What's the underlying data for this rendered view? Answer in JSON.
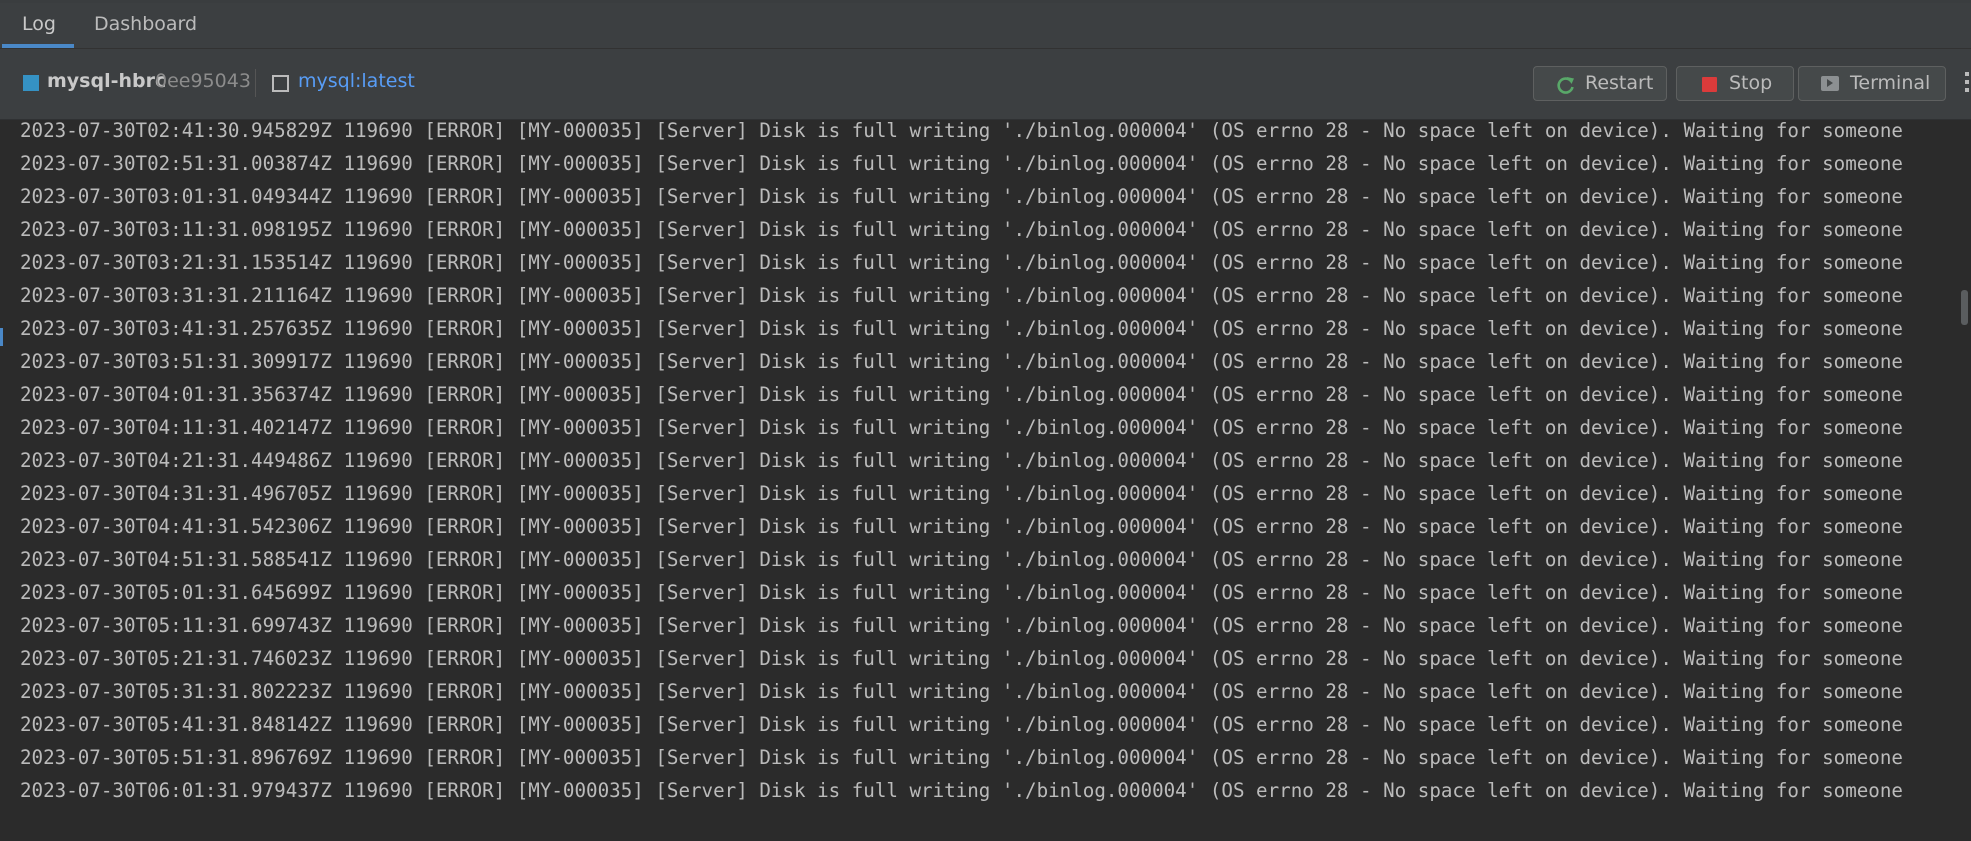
{
  "tabs": [
    {
      "label": "Log",
      "active": true
    },
    {
      "label": "Dashboard",
      "active": false
    }
  ],
  "toolbar": {
    "container_name": "mysql-hbrc",
    "container_id": "0ee95043",
    "image_name": "mysql:latest",
    "restart_label": "Restart",
    "stop_label": "Stop",
    "terminal_label": "Terminal"
  },
  "log": {
    "lines": [
      "2023-07-30T02:41:30.945829Z 119690 [ERROR] [MY-000035] [Server] Disk is full writing './binlog.000004' (OS errno 28 - No space left on device). Waiting for someone",
      "2023-07-30T02:51:31.003874Z 119690 [ERROR] [MY-000035] [Server] Disk is full writing './binlog.000004' (OS errno 28 - No space left on device). Waiting for someone",
      "2023-07-30T03:01:31.049344Z 119690 [ERROR] [MY-000035] [Server] Disk is full writing './binlog.000004' (OS errno 28 - No space left on device). Waiting for someone",
      "2023-07-30T03:11:31.098195Z 119690 [ERROR] [MY-000035] [Server] Disk is full writing './binlog.000004' (OS errno 28 - No space left on device). Waiting for someone",
      "2023-07-30T03:21:31.153514Z 119690 [ERROR] [MY-000035] [Server] Disk is full writing './binlog.000004' (OS errno 28 - No space left on device). Waiting for someone",
      "2023-07-30T03:31:31.211164Z 119690 [ERROR] [MY-000035] [Server] Disk is full writing './binlog.000004' (OS errno 28 - No space left on device). Waiting for someone",
      "2023-07-30T03:41:31.257635Z 119690 [ERROR] [MY-000035] [Server] Disk is full writing './binlog.000004' (OS errno 28 - No space left on device). Waiting for someone",
      "2023-07-30T03:51:31.309917Z 119690 [ERROR] [MY-000035] [Server] Disk is full writing './binlog.000004' (OS errno 28 - No space left on device). Waiting for someone",
      "2023-07-30T04:01:31.356374Z 119690 [ERROR] [MY-000035] [Server] Disk is full writing './binlog.000004' (OS errno 28 - No space left on device). Waiting for someone",
      "2023-07-30T04:11:31.402147Z 119690 [ERROR] [MY-000035] [Server] Disk is full writing './binlog.000004' (OS errno 28 - No space left on device). Waiting for someone",
      "2023-07-30T04:21:31.449486Z 119690 [ERROR] [MY-000035] [Server] Disk is full writing './binlog.000004' (OS errno 28 - No space left on device). Waiting for someone",
      "2023-07-30T04:31:31.496705Z 119690 [ERROR] [MY-000035] [Server] Disk is full writing './binlog.000004' (OS errno 28 - No space left on device). Waiting for someone",
      "2023-07-30T04:41:31.542306Z 119690 [ERROR] [MY-000035] [Server] Disk is full writing './binlog.000004' (OS errno 28 - No space left on device). Waiting for someone",
      "2023-07-30T04:51:31.588541Z 119690 [ERROR] [MY-000035] [Server] Disk is full writing './binlog.000004' (OS errno 28 - No space left on device). Waiting for someone",
      "2023-07-30T05:01:31.645699Z 119690 [ERROR] [MY-000035] [Server] Disk is full writing './binlog.000004' (OS errno 28 - No space left on device). Waiting for someone",
      "2023-07-30T05:11:31.699743Z 119690 [ERROR] [MY-000035] [Server] Disk is full writing './binlog.000004' (OS errno 28 - No space left on device). Waiting for someone",
      "2023-07-30T05:21:31.746023Z 119690 [ERROR] [MY-000035] [Server] Disk is full writing './binlog.000004' (OS errno 28 - No space left on device). Waiting for someone",
      "2023-07-30T05:31:31.802223Z 119690 [ERROR] [MY-000035] [Server] Disk is full writing './binlog.000004' (OS errno 28 - No space left on device). Waiting for someone",
      "2023-07-30T05:41:31.848142Z 119690 [ERROR] [MY-000035] [Server] Disk is full writing './binlog.000004' (OS errno 28 - No space left on device). Waiting for someone",
      "2023-07-30T05:51:31.896769Z 119690 [ERROR] [MY-000035] [Server] Disk is full writing './binlog.000004' (OS errno 28 - No space left on device). Waiting for someone",
      "2023-07-30T06:01:31.979437Z 119690 [ERROR] [MY-000035] [Server] Disk is full writing './binlog.000004' (OS errno 28 - No space left on device). Waiting for someone"
    ]
  },
  "icons": {
    "container": "container-icon",
    "image": "image-icon",
    "restart": "restart-icon",
    "stop": "stop-icon",
    "terminal": "terminal-icon",
    "more": "more-options-icon"
  },
  "colors": {
    "accent": "#4a88c7",
    "link": "#589df6",
    "stop": "#db3b3b",
    "restart": "#59a869",
    "container": "#3592c4"
  }
}
